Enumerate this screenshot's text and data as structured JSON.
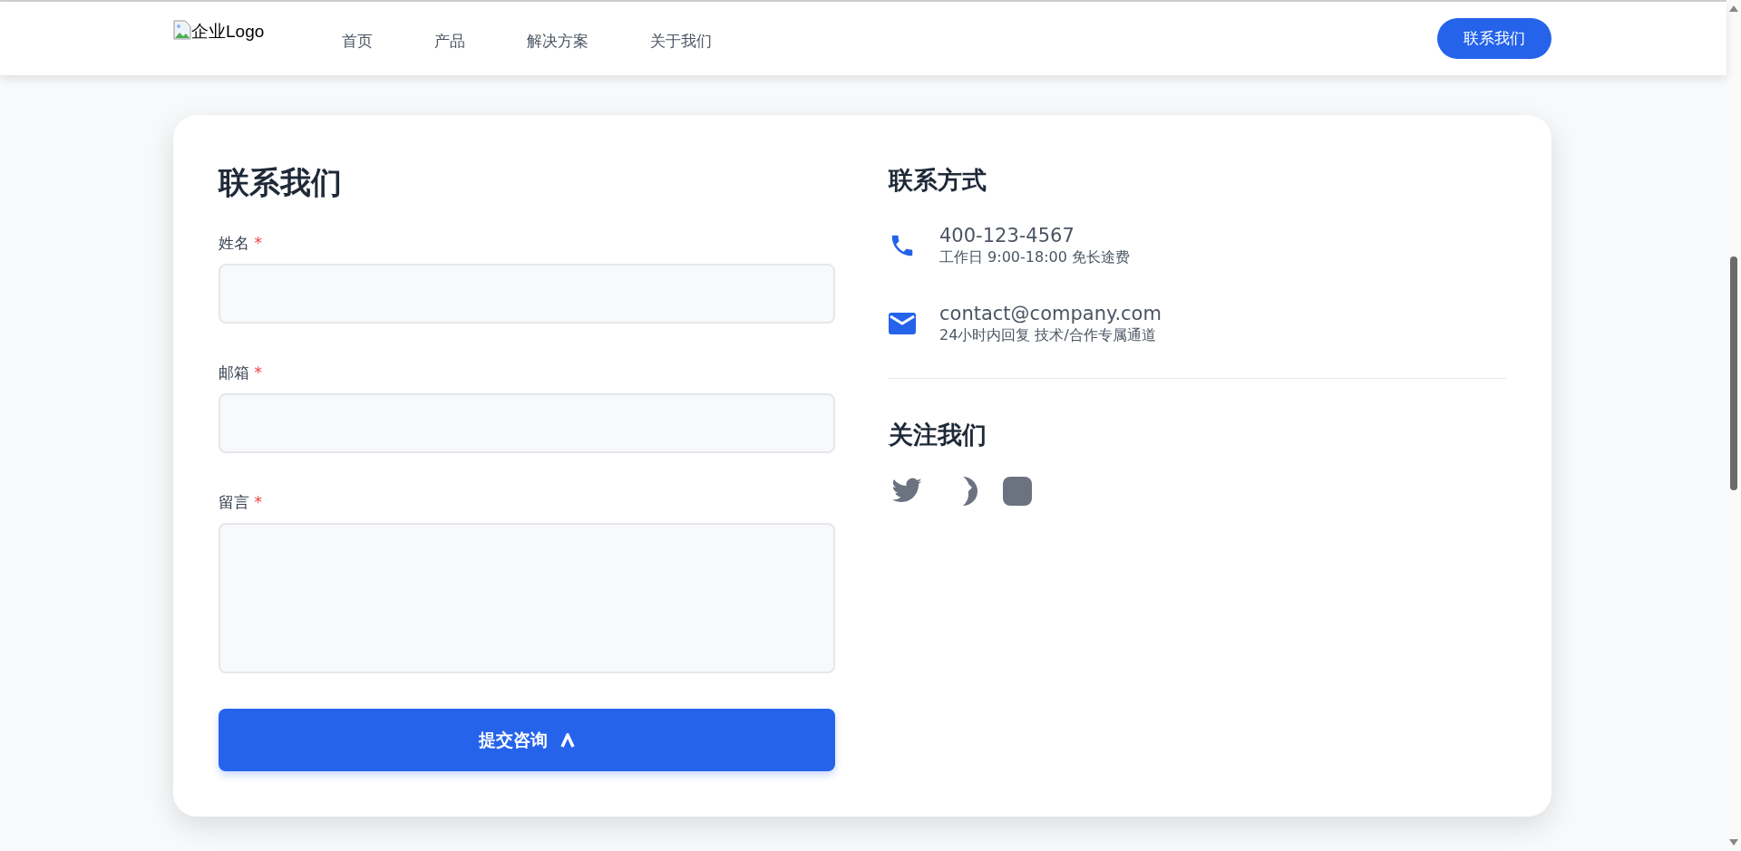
{
  "header": {
    "logo_alt": "企业Logo",
    "nav": [
      {
        "label": "首页"
      },
      {
        "label": "产品"
      },
      {
        "label": "解决方案"
      },
      {
        "label": "关于我们"
      }
    ],
    "cta": "联系我们"
  },
  "form": {
    "title": "联系我们",
    "fields": [
      {
        "label": "姓名",
        "required_mark": "*",
        "kind": "input"
      },
      {
        "label": "邮箱",
        "required_mark": "*",
        "kind": "input"
      },
      {
        "label": "留言",
        "required_mark": "*",
        "kind": "textarea"
      }
    ],
    "submit": "提交咨询"
  },
  "contact": {
    "title": "联系方式",
    "items": [
      {
        "kind": "phone",
        "value": "400-123-4567",
        "note": "工作日 9:00-18:00 免长途费"
      },
      {
        "kind": "email",
        "value": "contact@company.com",
        "note": "24小时内回复 技术/合作专属通道"
      }
    ]
  },
  "social": {
    "title": "关注我们",
    "links": [
      {
        "kind": "bird"
      },
      {
        "kind": "partial"
      },
      {
        "kind": "square"
      }
    ]
  }
}
